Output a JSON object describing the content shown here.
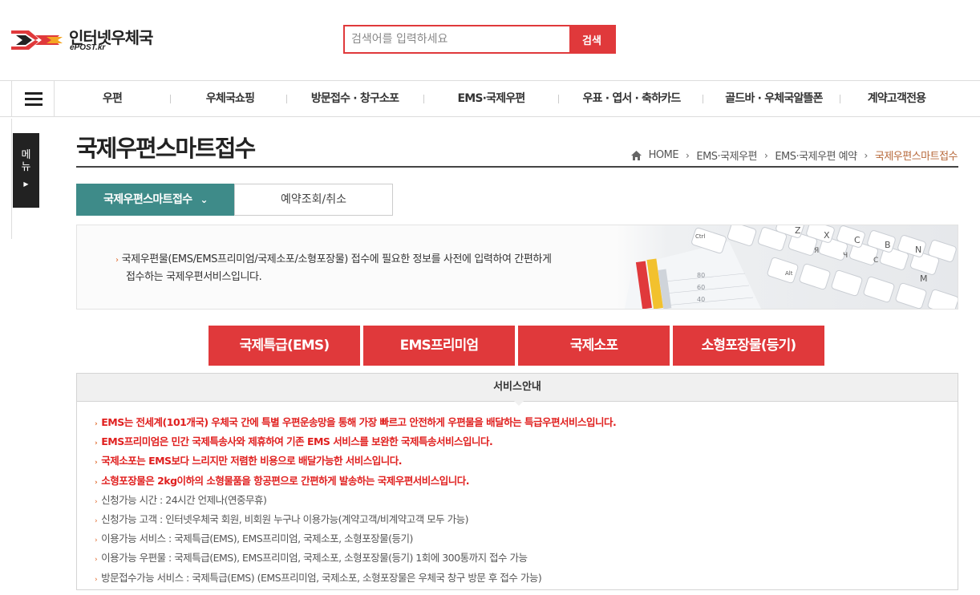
{
  "header": {
    "logo_text": "인터넷우체국",
    "logo_sub": "ePOST.kr",
    "search_placeholder": "검색어를 입력하세요",
    "search_button": "검색"
  },
  "gnb": {
    "items": [
      "우편",
      "우체국쇼핑",
      "방문접수 · 창구소포",
      "EMS·국제우편",
      "우표 · 엽서 · 축하카드",
      "골드바 · 우체국알뜰폰",
      "계약고객전용"
    ]
  },
  "side_menu": {
    "label_1": "메",
    "label_2": "뉴",
    "arrow": "▶"
  },
  "page": {
    "title": "국제우편스마트접수",
    "breadcrumb": [
      "HOME",
      "EMS·국제우편",
      "EMS·국제우편 예약",
      "국제우편스마트접수"
    ]
  },
  "tabs": {
    "active": "국제우편스마트접수",
    "other": "예약조회/취소"
  },
  "intro": {
    "line1": "국제우편물(EMS/EMS프리미엄/국제소포/소형포장물) 접수에 필요한 정보를 사전에 입력하여 간편하게",
    "line2": "접수하는 국제우편서비스입니다."
  },
  "service_buttons": [
    "국제특급(EMS)",
    "EMS프리미엄",
    "국제소포",
    "소형포장물(등기)"
  ],
  "guide": {
    "title": "서비스안내",
    "red_items": [
      "EMS는 전세계(101개국) 우체국 간에 특별 우편운송망을 통해 가장 빠르고 안전하게 우편물을 배달하는 특급우편서비스입니다.",
      "EMS프리미엄은 민간 국제특송사와 제휴하여 기존 EMS 서비스를 보완한 국제특송서비스입니다.",
      "국제소포는 EMS보다 느리지만 저렴한 비용으로 배달가능한 서비스입니다.",
      "소형포장물은 2kg이하의 소형물품을 항공편으로 간편하게 발송하는 국제우편서비스입니다."
    ],
    "gray_items": [
      "신청가능 시간 : 24시간 언제나(연중무휴)",
      "신청가능 고객 : 인터넷우체국 회원, 비회원 누구나 이용가능(계약고객/비계약고객 모두 가능)",
      "이용가능 서비스 : 국제특급(EMS), EMS프리미엄, 국제소포, 소형포장물(등기)",
      "이용가능 우편물 : 국제특급(EMS), EMS프리미엄, 국제소포, 소형포장물(등기) 1회에 300통까지 접수 가능",
      "방문접수가능 서비스 : 국제특급(EMS) (EMS프리미엄, 국제소포, 소형포장물은 우체국 창구 방문 후 접수 가능)"
    ],
    "bullet": "›"
  },
  "colors": {
    "accent_red": "#e0393b",
    "tab_teal": "#3e8b89",
    "breadcrumb_current": "#b7683a",
    "bullet_orange": "#e06a2c"
  },
  "icons": [
    "epost-logo-icon",
    "hamburger-menu-icon",
    "home-icon",
    "chevron-down-icon",
    "chevron-right-icon"
  ]
}
